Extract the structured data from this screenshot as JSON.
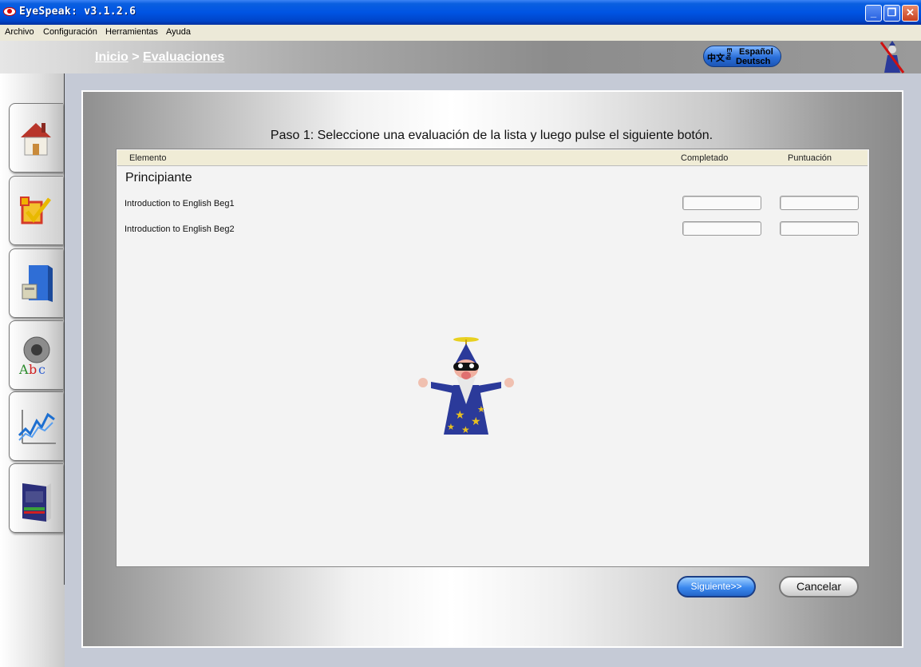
{
  "window": {
    "title": "EyeSpeak:  v3.1.2.6"
  },
  "menu": [
    "Archivo",
    "Configuración",
    "Herramientas",
    "Ayuda"
  ],
  "breadcrumb": {
    "home": "Inicio",
    "separator": ">",
    "current": "Evaluaciones"
  },
  "language_button": {
    "chinese": "中文",
    "english": "Eng",
    "spanish": "Español",
    "german": "Deutsch"
  },
  "sidebar": {
    "tabs": [
      {
        "name": "home",
        "icon": "house-icon",
        "active": false
      },
      {
        "name": "evaluations",
        "icon": "checkbox-icon",
        "active": true
      },
      {
        "name": "files",
        "icon": "file-cabinet-icon",
        "active": false
      },
      {
        "name": "pronunciation",
        "icon": "speaker-abc-icon",
        "active": false
      },
      {
        "name": "progress",
        "icon": "chart-icon",
        "active": false
      },
      {
        "name": "dictionary",
        "icon": "book-icon",
        "active": false
      }
    ]
  },
  "main": {
    "instruction": "Paso 1: Seleccione una evaluación de la lista y luego pulse el siguiente botón.",
    "columns": {
      "item": "Elemento",
      "completed": "Completado",
      "score": "Puntuación"
    },
    "group": "Principiante",
    "rows": [
      {
        "label": "Introduction to English Beg1",
        "completed": "",
        "score": ""
      },
      {
        "label": "Introduction to English Beg2",
        "completed": "",
        "score": ""
      }
    ]
  },
  "buttons": {
    "next": "Siguiente>>",
    "cancel": "Cancelar"
  },
  "colors": {
    "titlebar": "#0054e3",
    "accent_button": "#3b88ee",
    "menubar": "#ece9d8"
  }
}
